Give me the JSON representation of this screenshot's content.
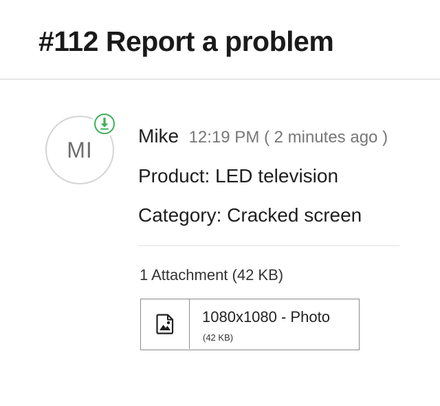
{
  "ticket": {
    "title": "#112 Report a problem"
  },
  "message": {
    "avatar_initials": "MI",
    "author": "Mike",
    "timestamp": "12:19 PM ( 2 minutes ago )",
    "lines": [
      "Product: LED television",
      "Category: Cracked screen"
    ],
    "direction_icon": "incoming-arrow-icon"
  },
  "attachments": {
    "heading": "1 Attachment (42 KB)",
    "items": [
      {
        "name": "1080x1080 - Photo",
        "size": "(42 KB)",
        "icon": "image-file-icon"
      }
    ]
  },
  "colors": {
    "accent_green": "#3fae5a",
    "muted_text": "#777777",
    "border": "#8a8a8a"
  }
}
